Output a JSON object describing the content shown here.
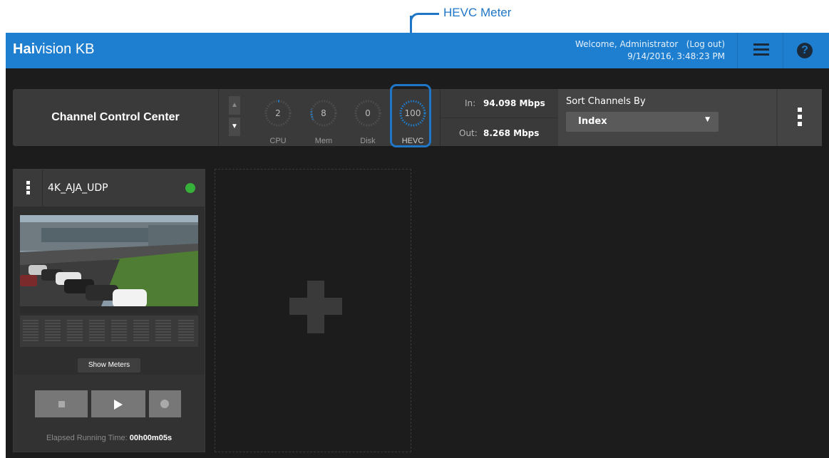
{
  "annotation": {
    "label": "HEVC Meter"
  },
  "header": {
    "brand_bold": "Hai",
    "brand_rest": "vision KB",
    "welcome": "Welcome, Administrator",
    "logout": "(Log out)",
    "datetime": "9/14/2016, 3:48:23 PM",
    "menu_icon": "hamburger-icon",
    "help_icon": "help-icon",
    "accent": "#1e7fd1"
  },
  "control_bar": {
    "title": "Channel Control Center",
    "gauges": [
      {
        "name": "cpu",
        "value": "2",
        "label": "CPU"
      },
      {
        "name": "mem",
        "value": "8",
        "label": "Mem"
      },
      {
        "name": "disk",
        "value": "0",
        "label": "Disk"
      },
      {
        "name": "hevc",
        "value": "100",
        "label": "HEVC"
      }
    ],
    "in_label": "In:",
    "in_value": "94.098 Mbps",
    "out_label": "Out:",
    "out_value": "8.268 Mbps",
    "sort_title": "Sort Channels By",
    "sort_selected": "Index"
  },
  "channel": {
    "name": "4K_AJA_UDP",
    "status_color": "#36b13a",
    "show_meters": "Show Meters",
    "elapsed_label": "Elapsed Running Time:",
    "elapsed_value": "00h00m05s"
  }
}
